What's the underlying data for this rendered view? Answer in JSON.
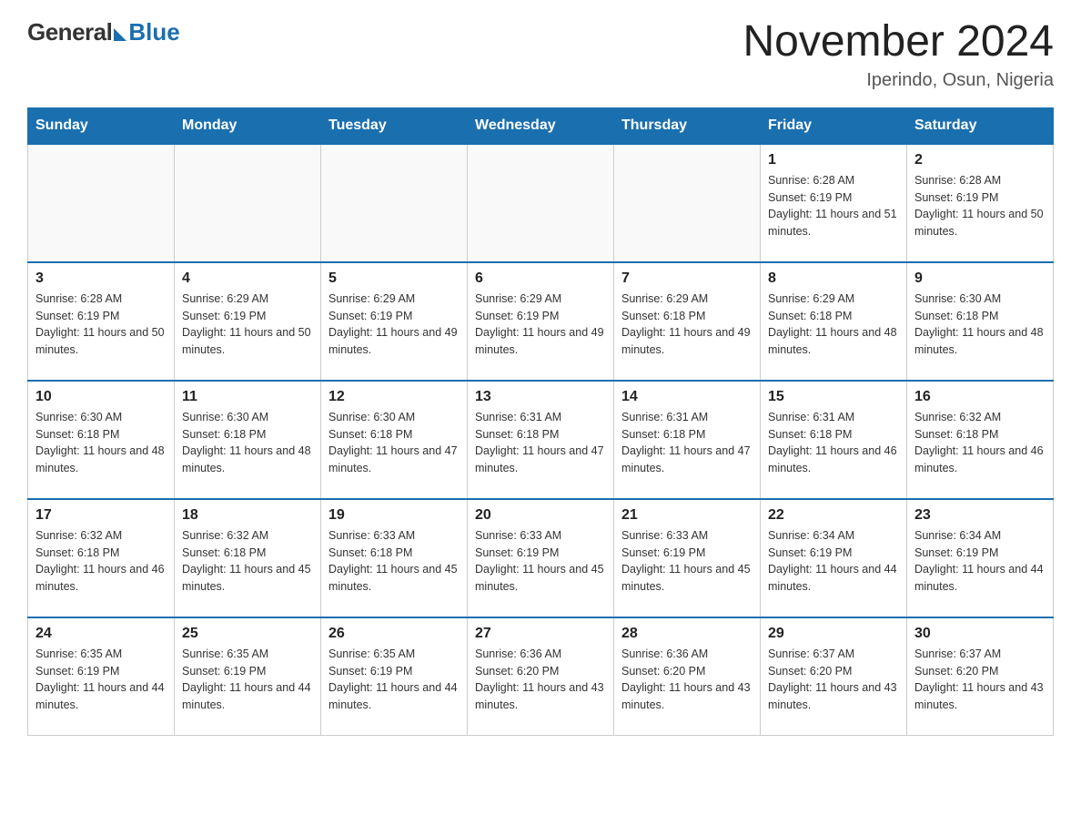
{
  "header": {
    "logo_general": "General",
    "logo_blue": "Blue",
    "calendar_title": "November 2024",
    "calendar_subtitle": "Iperindo, Osun, Nigeria"
  },
  "weekdays": [
    "Sunday",
    "Monday",
    "Tuesday",
    "Wednesday",
    "Thursday",
    "Friday",
    "Saturday"
  ],
  "weeks": [
    [
      {
        "day": "",
        "info": ""
      },
      {
        "day": "",
        "info": ""
      },
      {
        "day": "",
        "info": ""
      },
      {
        "day": "",
        "info": ""
      },
      {
        "day": "",
        "info": ""
      },
      {
        "day": "1",
        "info": "Sunrise: 6:28 AM\nSunset: 6:19 PM\nDaylight: 11 hours and 51 minutes."
      },
      {
        "day": "2",
        "info": "Sunrise: 6:28 AM\nSunset: 6:19 PM\nDaylight: 11 hours and 50 minutes."
      }
    ],
    [
      {
        "day": "3",
        "info": "Sunrise: 6:28 AM\nSunset: 6:19 PM\nDaylight: 11 hours and 50 minutes."
      },
      {
        "day": "4",
        "info": "Sunrise: 6:29 AM\nSunset: 6:19 PM\nDaylight: 11 hours and 50 minutes."
      },
      {
        "day": "5",
        "info": "Sunrise: 6:29 AM\nSunset: 6:19 PM\nDaylight: 11 hours and 49 minutes."
      },
      {
        "day": "6",
        "info": "Sunrise: 6:29 AM\nSunset: 6:19 PM\nDaylight: 11 hours and 49 minutes."
      },
      {
        "day": "7",
        "info": "Sunrise: 6:29 AM\nSunset: 6:18 PM\nDaylight: 11 hours and 49 minutes."
      },
      {
        "day": "8",
        "info": "Sunrise: 6:29 AM\nSunset: 6:18 PM\nDaylight: 11 hours and 48 minutes."
      },
      {
        "day": "9",
        "info": "Sunrise: 6:30 AM\nSunset: 6:18 PM\nDaylight: 11 hours and 48 minutes."
      }
    ],
    [
      {
        "day": "10",
        "info": "Sunrise: 6:30 AM\nSunset: 6:18 PM\nDaylight: 11 hours and 48 minutes."
      },
      {
        "day": "11",
        "info": "Sunrise: 6:30 AM\nSunset: 6:18 PM\nDaylight: 11 hours and 48 minutes."
      },
      {
        "day": "12",
        "info": "Sunrise: 6:30 AM\nSunset: 6:18 PM\nDaylight: 11 hours and 47 minutes."
      },
      {
        "day": "13",
        "info": "Sunrise: 6:31 AM\nSunset: 6:18 PM\nDaylight: 11 hours and 47 minutes."
      },
      {
        "day": "14",
        "info": "Sunrise: 6:31 AM\nSunset: 6:18 PM\nDaylight: 11 hours and 47 minutes."
      },
      {
        "day": "15",
        "info": "Sunrise: 6:31 AM\nSunset: 6:18 PM\nDaylight: 11 hours and 46 minutes."
      },
      {
        "day": "16",
        "info": "Sunrise: 6:32 AM\nSunset: 6:18 PM\nDaylight: 11 hours and 46 minutes."
      }
    ],
    [
      {
        "day": "17",
        "info": "Sunrise: 6:32 AM\nSunset: 6:18 PM\nDaylight: 11 hours and 46 minutes."
      },
      {
        "day": "18",
        "info": "Sunrise: 6:32 AM\nSunset: 6:18 PM\nDaylight: 11 hours and 45 minutes."
      },
      {
        "day": "19",
        "info": "Sunrise: 6:33 AM\nSunset: 6:18 PM\nDaylight: 11 hours and 45 minutes."
      },
      {
        "day": "20",
        "info": "Sunrise: 6:33 AM\nSunset: 6:19 PM\nDaylight: 11 hours and 45 minutes."
      },
      {
        "day": "21",
        "info": "Sunrise: 6:33 AM\nSunset: 6:19 PM\nDaylight: 11 hours and 45 minutes."
      },
      {
        "day": "22",
        "info": "Sunrise: 6:34 AM\nSunset: 6:19 PM\nDaylight: 11 hours and 44 minutes."
      },
      {
        "day": "23",
        "info": "Sunrise: 6:34 AM\nSunset: 6:19 PM\nDaylight: 11 hours and 44 minutes."
      }
    ],
    [
      {
        "day": "24",
        "info": "Sunrise: 6:35 AM\nSunset: 6:19 PM\nDaylight: 11 hours and 44 minutes."
      },
      {
        "day": "25",
        "info": "Sunrise: 6:35 AM\nSunset: 6:19 PM\nDaylight: 11 hours and 44 minutes."
      },
      {
        "day": "26",
        "info": "Sunrise: 6:35 AM\nSunset: 6:19 PM\nDaylight: 11 hours and 44 minutes."
      },
      {
        "day": "27",
        "info": "Sunrise: 6:36 AM\nSunset: 6:20 PM\nDaylight: 11 hours and 43 minutes."
      },
      {
        "day": "28",
        "info": "Sunrise: 6:36 AM\nSunset: 6:20 PM\nDaylight: 11 hours and 43 minutes."
      },
      {
        "day": "29",
        "info": "Sunrise: 6:37 AM\nSunset: 6:20 PM\nDaylight: 11 hours and 43 minutes."
      },
      {
        "day": "30",
        "info": "Sunrise: 6:37 AM\nSunset: 6:20 PM\nDaylight: 11 hours and 43 minutes."
      }
    ]
  ]
}
